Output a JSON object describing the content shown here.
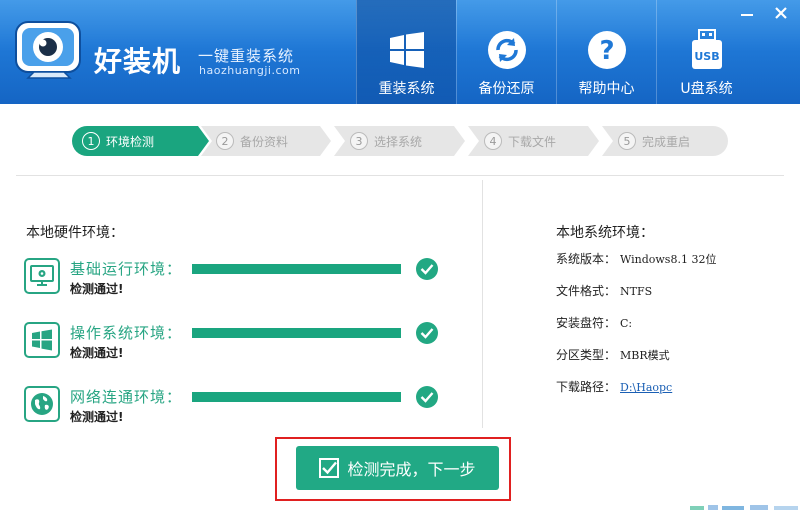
{
  "header": {
    "brand": "好装机",
    "slogan": "一键重装系统",
    "domain": "haozhuangji.com",
    "nav": [
      {
        "label": "重装系统",
        "icon": "windows-logo-icon",
        "active": true
      },
      {
        "label": "备份还原",
        "icon": "refresh-icon",
        "active": false
      },
      {
        "label": "帮助中心",
        "icon": "help-icon",
        "active": false
      },
      {
        "label": "U盘系统",
        "icon": "usb-icon",
        "active": false
      }
    ]
  },
  "steps": [
    {
      "num": "1",
      "label": "环境检测",
      "active": true
    },
    {
      "num": "2",
      "label": "备份资料",
      "active": false
    },
    {
      "num": "3",
      "label": "选择系统",
      "active": false
    },
    {
      "num": "4",
      "label": "下载文件",
      "active": false
    },
    {
      "num": "5",
      "label": "完成重启",
      "active": false
    }
  ],
  "hardware": {
    "title": "本地硬件环境：",
    "checks": [
      {
        "name": "基础运行环境：",
        "status": "检测通过!",
        "icon": "monitor-gear-icon",
        "progress": 1.0
      },
      {
        "name": "操作系统环境：",
        "status": "检测通过!",
        "icon": "windows-icon",
        "progress": 1.0
      },
      {
        "name": "网络连通环境：",
        "status": "检测通过!",
        "icon": "globe-icon",
        "progress": 1.0
      }
    ]
  },
  "system": {
    "title": "本地系统环境：",
    "rows": [
      {
        "label": "系统版本：",
        "value": "Windows8.1  32位"
      },
      {
        "label": "文件格式：",
        "value": "NTFS"
      },
      {
        "label": "安装盘符：",
        "value": "C:"
      },
      {
        "label": "分区类型：",
        "value": "MBR模式"
      },
      {
        "label": "下载路径：",
        "value": "D:\\Haopc"
      }
    ]
  },
  "action": {
    "next_label": "检测完成，下一步"
  },
  "colors": {
    "header": "#1f78d6",
    "accent": "#21a985",
    "highlight": "#e02020"
  }
}
